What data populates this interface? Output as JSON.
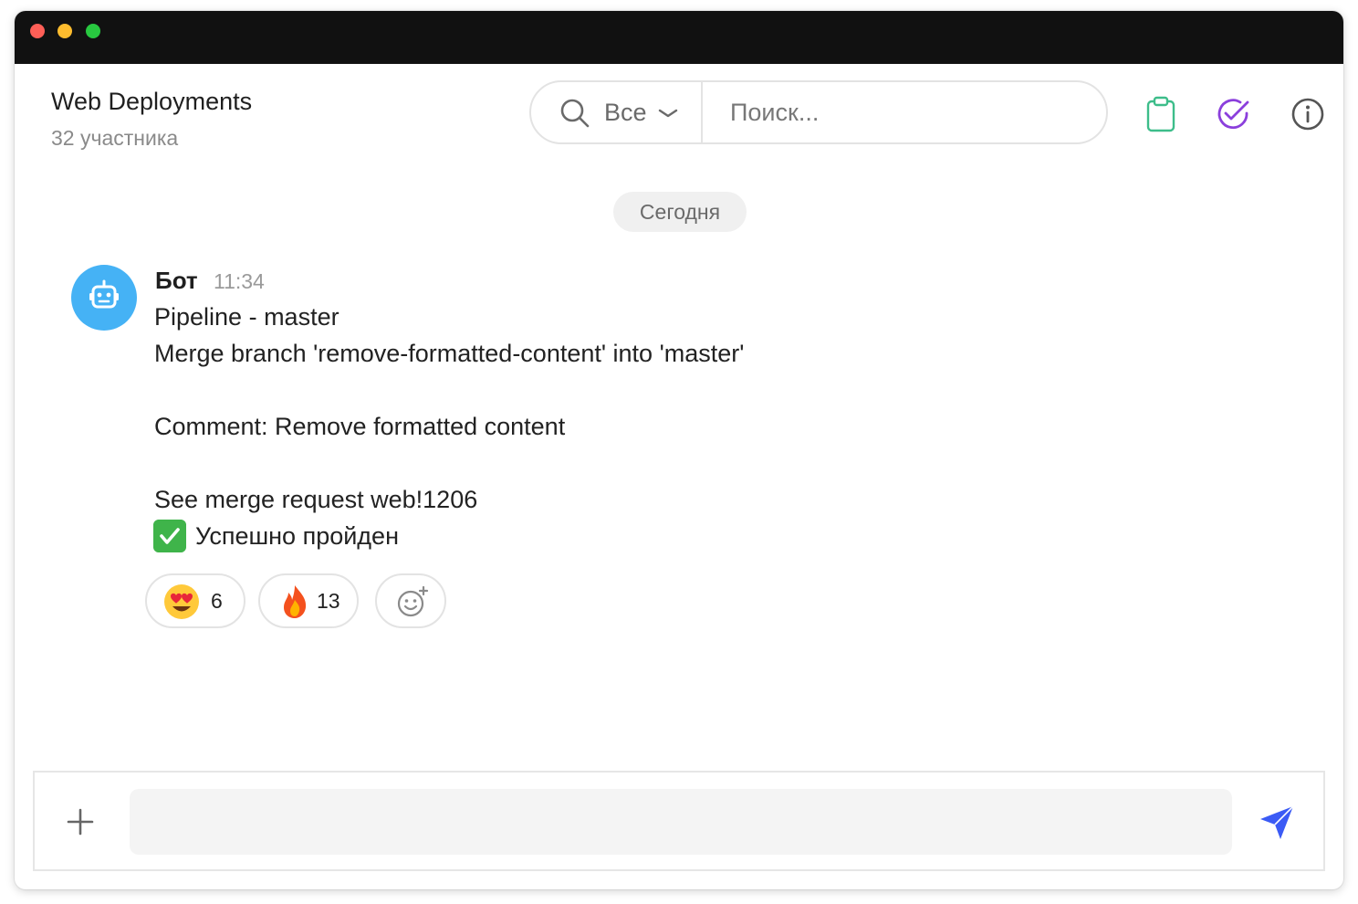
{
  "header": {
    "title": "Web Deployments",
    "subtitle": "32 участника"
  },
  "search": {
    "scope_label": "Все",
    "placeholder": "Поиск..."
  },
  "header_actions": [
    "clipboard-icon",
    "check-circle-icon",
    "info-icon"
  ],
  "date_divider": "Сегодня",
  "message": {
    "author": "Бот",
    "time": "11:34",
    "lines": [
      "Pipeline - master",
      "Merge branch 'remove-formatted-content' into 'master'",
      "Comment: Remove formatted content",
      "See merge request web!1206",
      "Успешно пройден"
    ]
  },
  "reactions": [
    {
      "emoji": "heart-eyes-emoji",
      "count": "6"
    },
    {
      "emoji": "fire-emoji",
      "count": "13"
    }
  ],
  "colors": {
    "accent_send": "#3b5bf5",
    "check_icon": "#8b3fdc",
    "clipboard_icon": "#3dbd8a",
    "avatar_bg": "#45b2f5",
    "titlebar": "#111111"
  }
}
